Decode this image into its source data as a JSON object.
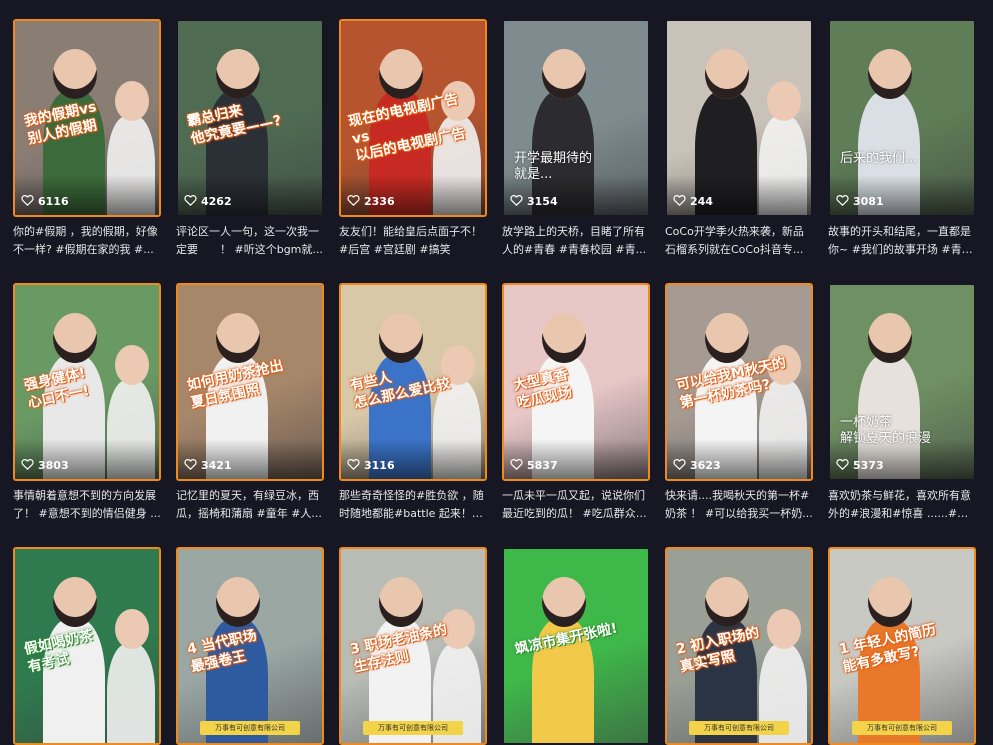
{
  "videos": [
    {
      "likes": "6116",
      "desc": "你的#假期 ，我的假期，好像不一样? #假期在家的我 #...",
      "overlay": "我的假期vs\n别人的假期",
      "bg": "#8a7d74",
      "accent": "#3b6b3a",
      "style": "orange"
    },
    {
      "likes": "4262",
      "desc": "评论区一人一句，这一次我一定要　　！ #听这个bgm就...",
      "overlay": "霸总归来\n他究竟要——?",
      "bg": "#4f6b52",
      "accent": "#2b2f36",
      "style": "plain"
    },
    {
      "likes": "2336",
      "desc": "友友们！能给皇后点面子不！ #后宫 #宫廷剧 #搞笑",
      "overlay": "现在的电视剧广告vs\n以后的电视剧广告",
      "bg": "#b5542e",
      "accent": "#c62a22",
      "style": "orange"
    },
    {
      "likes": "3154",
      "desc": "放学路上的天桥，目睹了所有人的#青春 #青春校园 #青...",
      "overlay": "开学最期待的\n就是...",
      "bg": "#7f8c8f",
      "accent": "#2c2c30",
      "style": "plain",
      "hand": true
    },
    {
      "likes": "244",
      "desc": "CoCo开学季火热来袭，新品石榴系列就在CoCo抖音专...",
      "overlay": "",
      "bg": "#c9c2b8",
      "accent": "#1f1f22",
      "style": "plain"
    },
    {
      "likes": "3081",
      "desc": "故事的开头和结尾，一直都是你~ #我们的故事开场 #青春...",
      "overlay": "后来的我们...",
      "bg": "#5f7d56",
      "accent": "#d9dfe4",
      "style": "plain",
      "hand": true
    },
    {
      "likes": "3803",
      "desc": "事情朝着意想不到的方向发展了！ #意想不到的情侣健身 ...",
      "overlay": "强身健体!\n心口不一!",
      "bg": "#6a9a64",
      "accent": "#e8e8e8",
      "style": "orange"
    },
    {
      "likes": "3421",
      "desc": "记忆里的夏天，有绿豆冰，西瓜，摇椅和蒲扇 #童年 #人...",
      "overlay": "如何用奶茶抢出\n夏日氛围照",
      "bg": "#a7876a",
      "accent": "#f1f1f1",
      "style": "orange"
    },
    {
      "likes": "3116",
      "desc": "那些奇奇怪怪的#胜负欲 ，随时随地都能#battle 起来！ #...",
      "overlay": "有些人\n怎么那么爱比较",
      "bg": "#d8c8a8",
      "accent": "#3a73c7",
      "style": "orange"
    },
    {
      "likes": "5837",
      "desc": "一瓜未平一瓜又起，说说你们最近吃到的瓜！ #吃瓜群众#...",
      "overlay": "大型真香\n吃瓜现场",
      "bg": "#e8c7c7",
      "accent": "#f5f5f5",
      "style": "orange"
    },
    {
      "likes": "3623",
      "desc": "快来请....我喝秋天的第一杯#奶茶 ！ #可以给我买一杯奶...",
      "overlay": "可以给我M秋天的\n第一杯奶茶吗?",
      "bg": "#a59b93",
      "accent": "#f4f4f4",
      "style": "orange"
    },
    {
      "likes": "5373",
      "desc": "喜欢奶茶与鲜花，喜欢所有意外的#浪漫和#惊喜 ......#七...",
      "overlay": "一杯奶茶\n解锁夏天的浪漫",
      "bg": "#6f9062",
      "accent": "#e6e1dc",
      "style": "plain",
      "hand": true
    },
    {
      "likes": "",
      "desc": "",
      "overlay": "假如喝奶茶\n有考试",
      "bg": "#2f7a4e",
      "accent": "#f0f0f0",
      "style": "orange",
      "green": true
    },
    {
      "likes": "",
      "desc": "",
      "overlay": "4 当代职场\n最强卷王",
      "bg": "#9aa7a3",
      "accent": "#2e5aa0",
      "style": "orange",
      "badge": "万事有可创意有限公司"
    },
    {
      "likes": "",
      "desc": "",
      "overlay": "3 职场老油条的\n生存法则",
      "bg": "#b8bcb5",
      "accent": "#f2f2f2",
      "style": "orange",
      "badge": "万事有可创意有限公司"
    },
    {
      "likes": "",
      "desc": "",
      "overlay": "飒凉市集开张啦!",
      "bg": "#3fb84a",
      "accent": "#f3c94a",
      "style": "plain",
      "green": true
    },
    {
      "likes": "",
      "desc": "",
      "overlay": "2 初入职场的\n真实写照",
      "bg": "#9aa096",
      "accent": "#2a3445",
      "style": "orange",
      "badge": "万事有可创意有限公司"
    },
    {
      "likes": "",
      "desc": "",
      "overlay": "1 年轻人的简历\n能有多敢写?",
      "bg": "#c8c9c3",
      "accent": "#e8782a",
      "style": "orange",
      "badge": "万事有可创意有限公司"
    }
  ]
}
